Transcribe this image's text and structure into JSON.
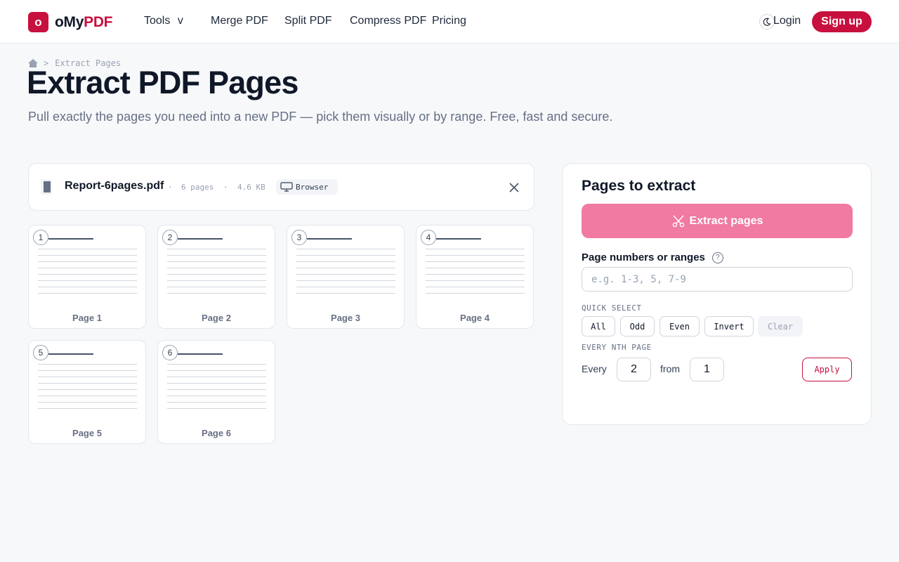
{
  "brand": {
    "logo_letter": "o",
    "name_part1": "oMy",
    "name_part2": "PDF",
    "accent_color": "#c8103e"
  },
  "nav": {
    "tools": "Tools",
    "tools_caret": "v",
    "merge": "Merge PDF",
    "split": "Split PDF",
    "compress": "Compress PDF",
    "pricing": "Pricing",
    "login": "Login",
    "signup": "Sign up",
    "theme_icon": "moon-icon"
  },
  "breadcrumb": {
    "home_icon": "home-icon",
    "separator": ">",
    "current": "Extract Pages"
  },
  "hero": {
    "title": "Extract PDF Pages",
    "subtitle": "Pull exactly the pages you need into a new PDF — pick them visually or by range. Free, fast and secure."
  },
  "file": {
    "name": "Report-6pages.pdf",
    "dot": "·",
    "pages": "6 pages",
    "size": "4.6 KB",
    "mode": "Browser",
    "mode_icon": "monitor-icon",
    "close_icon": "close-icon"
  },
  "thumbnails": [
    {
      "num": "1",
      "label": "Page 1"
    },
    {
      "num": "2",
      "label": "Page 2"
    },
    {
      "num": "3",
      "label": "Page 3"
    },
    {
      "num": "4",
      "label": "Page 4"
    },
    {
      "num": "5",
      "label": "Page 5"
    },
    {
      "num": "6",
      "label": "Page 6"
    }
  ],
  "panel": {
    "title": "Pages to extract",
    "extract_button": "Extract pages",
    "extract_icon": "scissors-icon",
    "range_label": "Page numbers or ranges",
    "help": "?",
    "range_placeholder": "e.g. 1-3, 5, 7-9",
    "range_value": "",
    "quick_select_label": "QUICK SELECT",
    "quick": {
      "all": "All",
      "odd": "Odd",
      "even": "Even",
      "invert": "Invert",
      "clear": "Clear"
    },
    "nth_label": "EVERY NTH PAGE",
    "every": "Every",
    "every_value": "2",
    "from": "from",
    "from_value": "1",
    "apply": "Apply"
  }
}
